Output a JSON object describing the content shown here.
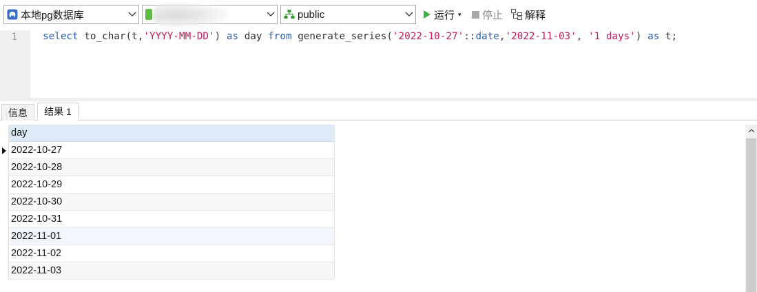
{
  "toolbar": {
    "connection": {
      "label": "本地pg数据库",
      "icon": "elephant-icon"
    },
    "database": {
      "label": "",
      "icon": "database-icon"
    },
    "schema": {
      "label": "public",
      "icon": "schema-icon"
    },
    "run_label": "运行",
    "run_dropdown": "▾",
    "stop_label": "停止",
    "explain_label": "解释"
  },
  "editor": {
    "line_numbers": [
      "1"
    ],
    "sql": "select to_char(t,'YYYY-MM-DD') as day from generate_series('2022-10-27'::date,'2022-11-03', '1 days') as t;"
  },
  "tabs": [
    {
      "label": "信息",
      "active": false
    },
    {
      "label": "结果 1",
      "active": true
    }
  ],
  "result": {
    "columns": [
      "day"
    ],
    "rows": [
      "2022-10-27",
      "2022-10-28",
      "2022-10-29",
      "2022-10-30",
      "2022-10-31",
      "2022-11-01",
      "2022-11-02",
      "2022-11-03"
    ],
    "selected_row": 0
  },
  "colors": {
    "run_green": "#3cb043",
    "header_blue": "#dcebf7",
    "keyword": "#2a5db0",
    "string": "#c2185b"
  }
}
